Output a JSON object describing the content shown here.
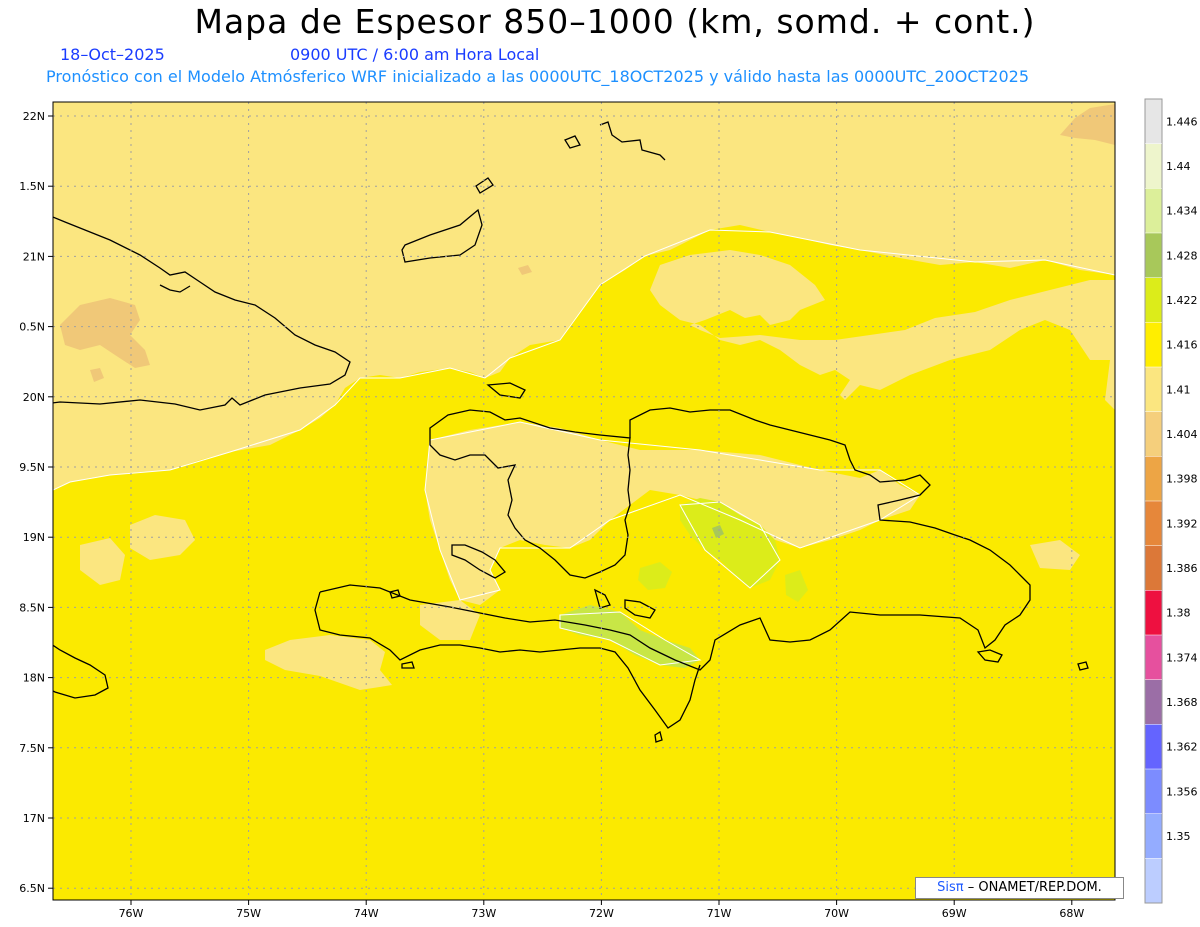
{
  "title": "Mapa de Espesor 850–1000 (km, somd. + cont.)",
  "date": "18–Oct–2025",
  "time": "0900 UTC / 6:00 am Hora Local",
  "forecast_info": "Pronóstico con el Modelo Atmósferico WRF inicializado a las 0000UTC_18OCT2025 y válido hasta las  0000UTC_20OCT2025",
  "lat_labels": [
    "22N",
    "1.5N",
    "21N",
    "0.5N",
    "20N",
    "9.5N",
    "19N",
    "8.5N",
    "18N",
    "7.5N",
    "17N",
    "6.5N"
  ],
  "lon_labels": [
    "76W",
    "75W",
    "74W",
    "73W",
    "72W",
    "71W",
    "70W",
    "69W",
    "68W"
  ],
  "colorbar": {
    "labels": [
      "1.446",
      "1.44",
      "1.434",
      "1.428",
      "1.422",
      "1.416",
      "1.41",
      "1.404",
      "1.398",
      "1.392",
      "1.386",
      "1.38",
      "1.374",
      "1.368",
      "1.362",
      "1.356",
      "1.35"
    ],
    "colors": [
      "#e6e6e6",
      "#eef5cc",
      "#dcef9a",
      "#a8c85a",
      "#dcec1a",
      "#ffee00",
      "#fbe680",
      "#f5cf7c",
      "#eda545",
      "#e6873a",
      "#dc7838",
      "#ee1040",
      "#e6509e",
      "#9b6ea6",
      "#6464ff",
      "#7c8cff",
      "#94acff",
      "#bccdff"
    ]
  },
  "credit": {
    "brand": "Sisπ",
    "text": "– ONAMET/REP.DOM."
  },
  "field_colors": {
    "base": "#fbea00",
    "light": "#fbe680",
    "orange": "#f0c878",
    "green": "#dcec1a",
    "lightgreen": "#c8e646"
  }
}
